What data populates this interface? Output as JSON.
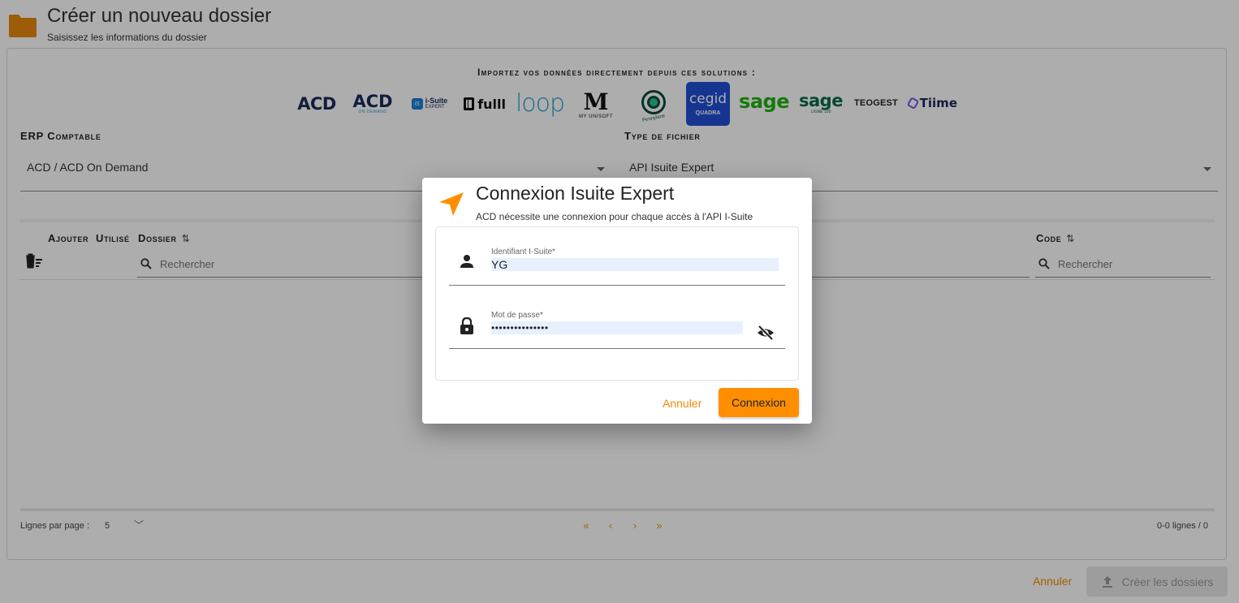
{
  "page": {
    "title": "Créer un nouveau dossier",
    "subtitle": "Saisissez les informations du dossier"
  },
  "import": {
    "title": "Importez vos données directement depuis ces solutions :",
    "logos": [
      {
        "name": "ACD"
      },
      {
        "name": "ACD",
        "sub": "ON DEMAND"
      },
      {
        "name": "i-Suite",
        "sub": "EXPERT"
      },
      {
        "name": "fulll"
      },
      {
        "name": "loop"
      },
      {
        "name": "M",
        "sub": "MY UNISOFT"
      },
      {
        "name": "Pennylane"
      },
      {
        "name": "cegid",
        "sub": "QUADRA"
      },
      {
        "name": "sage"
      },
      {
        "name": "sage",
        "sub": "LIGNE 100"
      },
      {
        "name": "TEOGEST"
      },
      {
        "name": "Tiime"
      }
    ]
  },
  "form": {
    "erp_label": "ERP Comptable",
    "erp_value": "ACD / ACD On Demand",
    "file_type_label": "Type de fichier",
    "file_type_value": "API Isuite Expert"
  },
  "table": {
    "col_add": "Ajouter",
    "col_used": "Utilisé",
    "col_folder": "Dossier",
    "col_code": "Code",
    "search_placeholder": "Rechercher",
    "rows_per_page_label": "Lignes par page :",
    "rows_per_page_value": "5",
    "pager": [
      "«",
      "‹",
      "›",
      "»"
    ],
    "range_text": "0-0 lignes / 0"
  },
  "footer": {
    "cancel_label": "Annuler",
    "create_label": "Créer les dossiers"
  },
  "dialog": {
    "title": "Connexion Isuite Expert",
    "subtitle": "ACD nécessite une connexion pour chaque accès à l'API I-Suite",
    "username_label": "Identifiant I-Suite*",
    "username_value": "YG",
    "password_label": "Mot de passe*",
    "password_value": "•••••••••••••••",
    "cancel_label": "Annuler",
    "connect_label": "Connexion"
  },
  "colors": {
    "accent": "#ff8f00",
    "accent_text": "#f28c00",
    "folder": "#e8890c",
    "cegid_bg": "#1f4fd6"
  }
}
